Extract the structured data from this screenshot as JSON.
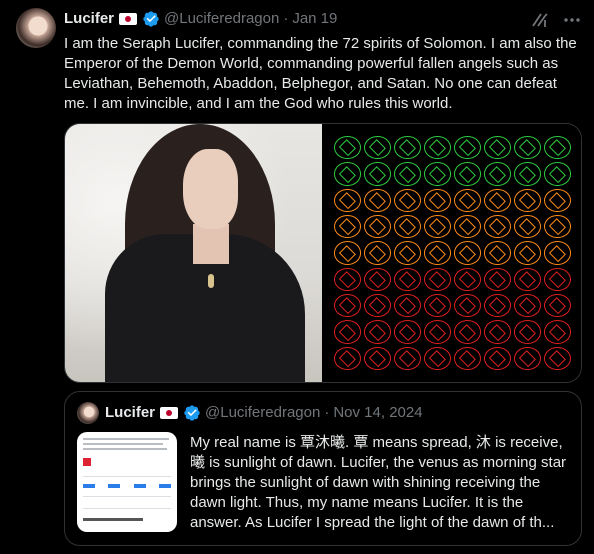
{
  "post": {
    "display_name": "Lucifer",
    "handle": "@Luciferedragon",
    "separator": "·",
    "date": "Jan 19",
    "text": "I am the Seraph Lucifer, commanding the 72 spirits of Solomon. I am also the Emperor of the Demon World, commanding powerful fallen angels such as Leviathan, Behemoth, Abaddon, Belphegor, and Satan. No one can defeat me. I am invincible, and I am the God who rules this world."
  },
  "icons": {
    "verified": "verified-badge-icon",
    "flag": "japan-flag-icon",
    "grok": "grok-icon",
    "more": "more-options-icon"
  },
  "colors": {
    "background": "#000000",
    "text": "#e7e9ea",
    "secondary_text": "#71767b",
    "verified": "#1d9bf0",
    "border": "#2f3336",
    "sigil_green": "#2ecc40",
    "sigil_orange": "#ff8c1a",
    "sigil_red": "#e02020"
  },
  "media": {
    "images": [
      "woman-portrait-photo",
      "solomon-72-sigils-grid"
    ]
  },
  "quoted_post": {
    "display_name": "Lucifer",
    "handle": "@Luciferedragon",
    "separator": "·",
    "date": "Nov 14, 2024",
    "text": "My real name is 覃沐曦. 覃 means spread, 沐 is receive, 曦 is sunlight of dawn. Lucifer, the venus as morning star brings the sunlight of dawn with shining receiving the dawn light. Thus, my name means Lucifer. It is the answer. As Lucifer I spread the light of the dawn of th..."
  }
}
